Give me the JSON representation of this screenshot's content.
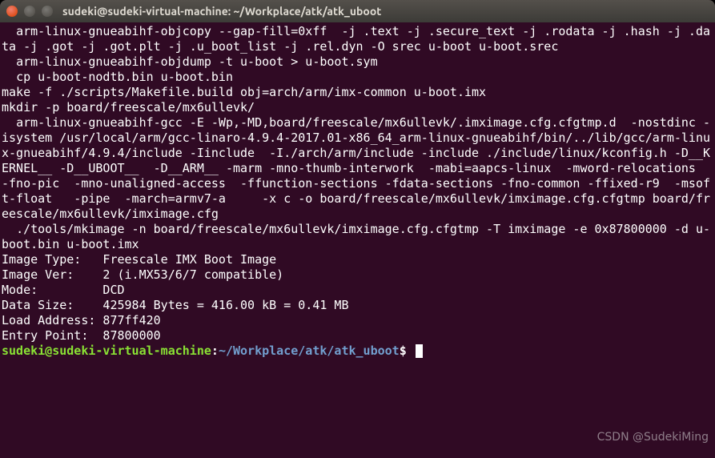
{
  "window": {
    "title": "sudeki@sudeki-virtual-machine: ~/Workplace/atk/atk_uboot"
  },
  "terminal": {
    "output": "  arm-linux-gnueabihf-objcopy --gap-fill=0xff  -j .text -j .secure_text -j .rodata -j .hash -j .data -j .got -j .got.plt -j .u_boot_list -j .rel.dyn -O srec u-boot u-boot.srec\n  arm-linux-gnueabihf-objdump -t u-boot > u-boot.sym\n  cp u-boot-nodtb.bin u-boot.bin\nmake -f ./scripts/Makefile.build obj=arch/arm/imx-common u-boot.imx\nmkdir -p board/freescale/mx6ullevk/\n  arm-linux-gnueabihf-gcc -E -Wp,-MD,board/freescale/mx6ullevk/.imximage.cfg.cfgtmp.d  -nostdinc -isystem /usr/local/arm/gcc-linaro-4.9.4-2017.01-x86_64_arm-linux-gnueabihf/bin/../lib/gcc/arm-linux-gnueabihf/4.9.4/include -Iinclude  -I./arch/arm/include -include ./include/linux/kconfig.h -D__KERNEL__ -D__UBOOT__  -D__ARM__ -marm -mno-thumb-interwork  -mabi=aapcs-linux  -mword-relocations  -fno-pic  -mno-unaligned-access  -ffunction-sections -fdata-sections -fno-common -ffixed-r9  -msoft-float   -pipe  -march=armv7-a     -x c -o board/freescale/mx6ullevk/imximage.cfg.cfgtmp board/freescale/mx6ullevk/imximage.cfg\n  ./tools/mkimage -n board/freescale/mx6ullevk/imximage.cfg.cfgtmp -T imximage -e 0x87800000 -d u-boot.bin u-boot.imx\nImage Type:   Freescale IMX Boot Image\nImage Ver:    2 (i.MX53/6/7 compatible)\nMode:         DCD\nData Size:    425984 Bytes = 416.00 kB = 0.41 MB\nLoad Address: 877ff420\nEntry Point:  87800000",
    "prompt": {
      "user_host": "sudeki@sudeki-virtual-machine",
      "sep1": ":",
      "path": "~/Workplace/atk/atk_uboot",
      "sep2": "$ "
    }
  },
  "watermark": "CSDN @SudekiMing",
  "colors": {
    "bg": "#300a24",
    "fg": "#ffffff",
    "user": "#8ae234",
    "path": "#729fcf"
  }
}
